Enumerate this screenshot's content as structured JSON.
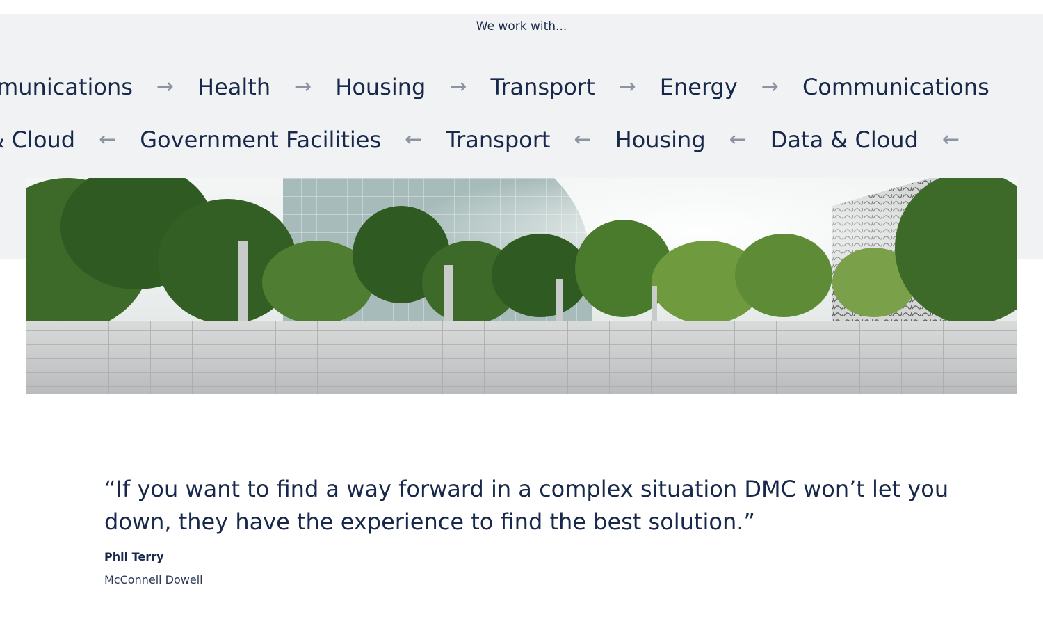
{
  "section": {
    "heading": "We work with..."
  },
  "ticker_top": {
    "items": [
      "Communications",
      "Health",
      "Housing",
      "Transport",
      "Energy",
      "Communications"
    ],
    "arrow": "→"
  },
  "ticker_bottom": {
    "items": [
      "Data & Cloud",
      "Government Facilities",
      "Transport",
      "Housing",
      "Data & Cloud"
    ],
    "arrow": "←"
  },
  "hero_image": {
    "alt": "Modern glass buildings with trees and paved plaza",
    "colors": {
      "sky": "#e9eef0",
      "glass": "#9fb6b4",
      "trees_dark": "#2f5a22",
      "trees_light": "#6f9a3e",
      "pavement": "#cfd1d2"
    }
  },
  "testimonial": {
    "quote": "“If you want to find a way forward in a complex situation DMC won’t let you down, they have the experience to find the best solution.”",
    "author": "Phil Terry",
    "company": "McConnell Dowell"
  },
  "colors": {
    "text": "#17284a",
    "band": "#f1f2f4",
    "arrow": "#8c93a2"
  }
}
